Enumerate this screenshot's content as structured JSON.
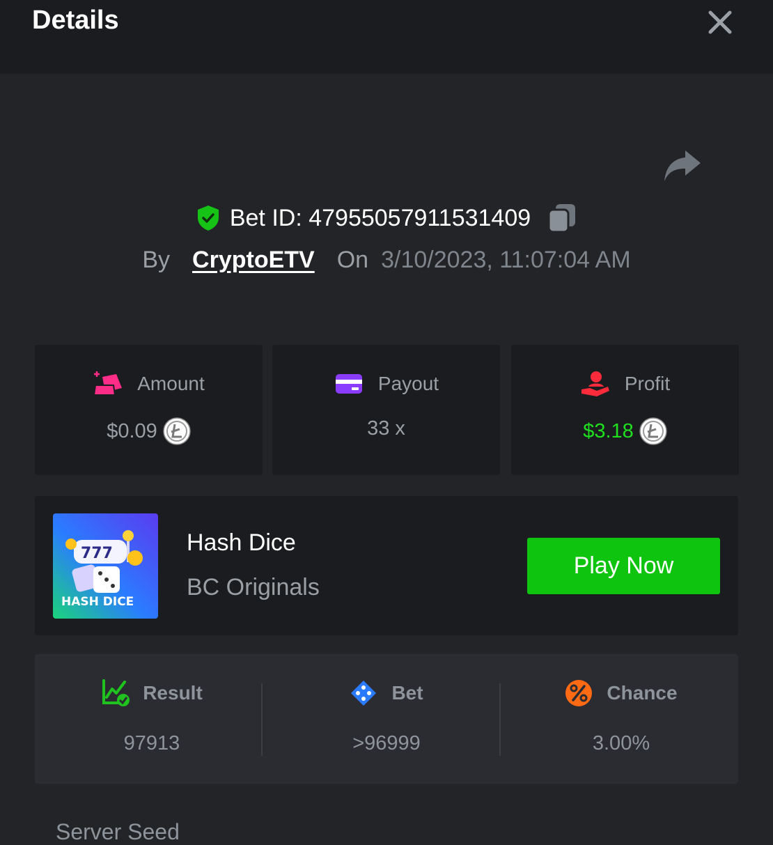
{
  "header": {
    "title": "Details",
    "close_icon": "close-icon"
  },
  "share_icon": "share-icon",
  "bet": {
    "id_label": "Bet ID: 47955057911531409",
    "by_label": "By",
    "user": "CryptoETV",
    "on_label": "On",
    "date": "3/10/2023, 11:07:04 AM"
  },
  "stats": [
    {
      "label": "Amount",
      "value": "$0.09",
      "icon": "amount-icon",
      "color": "#ff2d87",
      "coin": true
    },
    {
      "label": "Payout",
      "value": "33 x",
      "icon": "wallet-icon",
      "color": "#8a3cff",
      "coin": false
    },
    {
      "label": "Profit",
      "value": "$3.18",
      "icon": "profit-icon",
      "color": "#ff2b3b",
      "coin": true
    }
  ],
  "game": {
    "name": "Hash Dice",
    "provider": "BC Originals",
    "thumb_text": "HASH DICE",
    "play_label": "Play Now"
  },
  "results": [
    {
      "label": "Result",
      "value": "97913",
      "icon": "chart-check-icon",
      "color": "#1fc21f"
    },
    {
      "label": "Bet",
      "value": ">96999",
      "icon": "ticket-icon",
      "color": "#2a7bff"
    },
    {
      "label": "Chance",
      "value": "3.00%",
      "icon": "percent-icon",
      "color": "#ff6a13"
    }
  ],
  "server_seed_label": "Server Seed",
  "colors": {
    "background": "#232428",
    "header": "#1b1c1f",
    "card": "#1b1c1f",
    "accent_green": "#0ec40e",
    "profit_green": "#1fe01f"
  }
}
